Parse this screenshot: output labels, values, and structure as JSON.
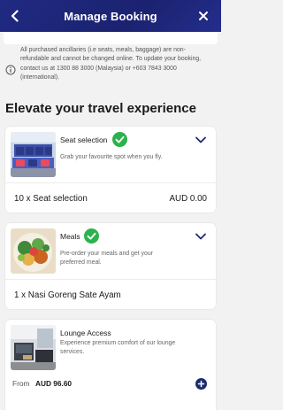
{
  "header": {
    "title": "Manage Booking",
    "back_icon": "chevron-left-icon",
    "close_icon": "close-icon"
  },
  "notice": {
    "icon": "info-icon",
    "text": "All purchased ancillaries (i.e seats, meals, baggage) are non-refundable and cannot be changed online. To update your booking, contact us at 1300 88 3000 (Malaysia) or +603 7843 3000 (international)."
  },
  "section": {
    "title": "Elevate your travel experience"
  },
  "cards": [
    {
      "name": "Seat selection",
      "description": "Grab your favourite spot when you fly.",
      "selected": true,
      "selection_label": "10 x Seat selection",
      "selection_price": "AUD 0.00"
    },
    {
      "name": "Meals",
      "description": "Pre-order your meals and get your preferred meal.",
      "selected": true,
      "selection_label": "1 x Nasi Goreng Sate Ayam"
    },
    {
      "name": "Lounge Access",
      "description": "Experience premium comfort of our lounge services.",
      "price_prefix": "From",
      "price": "AUD 96.60"
    }
  ],
  "colors": {
    "header_bg": "#202a82",
    "check_green": "#2bb24c",
    "accent_navy": "#1c2b6e"
  }
}
